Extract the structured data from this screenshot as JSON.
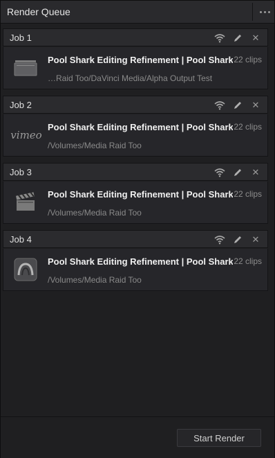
{
  "header": {
    "title": "Render Queue",
    "menu_icon": "more-horizontal-icon"
  },
  "jobs": [
    {
      "name": "Job 1",
      "title": "Pool Shark Editing Refinement | Pool Shark…",
      "clips": "22 clips",
      "path": "…Raid Too/DaVinci Media/Alpha Output Test",
      "thumb_icon": "render-preset-icon"
    },
    {
      "name": "Job 2",
      "title": "Pool Shark Editing Refinement | Pool Shark…",
      "clips": "22 clips",
      "path": "/Volumes/Media Raid Too",
      "thumb_icon": "vimeo-logo",
      "thumb_text": "vimeo"
    },
    {
      "name": "Job 3",
      "title": "Pool Shark Editing Refinement | Pool Shark…",
      "clips": "22 clips",
      "path": "/Volumes/Media Raid Too",
      "thumb_icon": "clapperboard-icon"
    },
    {
      "name": "Job 4",
      "title": "Pool Shark Editing Refinement | Pool Shark…",
      "clips": "22 clips",
      "path": "/Volumes/Media Raid Too",
      "thumb_icon": "avid-logo-icon"
    }
  ],
  "footer": {
    "start_render_label": "Start Render"
  },
  "colors": {
    "panel_bg": "#1f1f21",
    "job_header_bg": "#2b2b2e",
    "job_body_bg": "#26262a",
    "text": "#f0f0f0",
    "muted": "#8a8a8a"
  }
}
